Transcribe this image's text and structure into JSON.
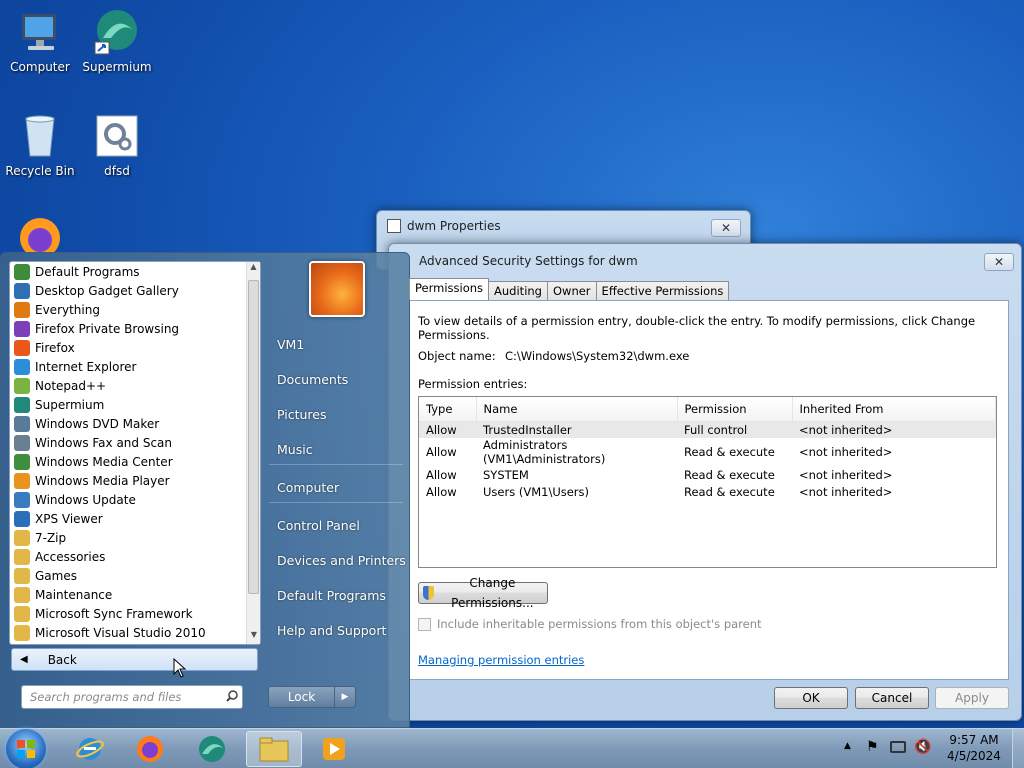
{
  "desktop": {
    "icons": [
      {
        "label": "Computer"
      },
      {
        "label": "Supermium"
      },
      {
        "label": "Recycle Bin"
      },
      {
        "label": "dfsd"
      }
    ]
  },
  "dwm_window": {
    "title": "dwm Properties",
    "close_label": "✕"
  },
  "adv_window": {
    "title": "Advanced Security Settings for dwm",
    "close_label": "✕",
    "tabs": [
      "Permissions",
      "Auditing",
      "Owner",
      "Effective Permissions"
    ],
    "instructions": "To view details of a permission entry, double-click the entry. To modify permissions, click Change Permissions.",
    "object_name_label": "Object name:",
    "object_name_value": "C:\\Windows\\System32\\dwm.exe",
    "entries_label": "Permission entries:",
    "columns": [
      "Type",
      "Name",
      "Permission",
      "Inherited From"
    ],
    "rows": [
      {
        "type": "Allow",
        "name": "TrustedInstaller",
        "permission": "Full control",
        "inherited": "<not inherited>"
      },
      {
        "type": "Allow",
        "name": "Administrators (VM1\\Administrators)",
        "permission": "Read & execute",
        "inherited": "<not inherited>"
      },
      {
        "type": "Allow",
        "name": "SYSTEM",
        "permission": "Read & execute",
        "inherited": "<not inherited>"
      },
      {
        "type": "Allow",
        "name": "Users (VM1\\Users)",
        "permission": "Read & execute",
        "inherited": "<not inherited>"
      }
    ],
    "change_button": "Change Permissions...",
    "inherit_checkbox": "Include inheritable permissions from this object's parent",
    "link": "Managing permission entries",
    "ok": "OK",
    "cancel": "Cancel",
    "apply": "Apply"
  },
  "start_menu": {
    "programs": [
      {
        "label": "Default Programs",
        "color": "#3c8c3c"
      },
      {
        "label": "Desktop Gadget Gallery",
        "color": "#2f6fb3"
      },
      {
        "label": "Everything",
        "color": "#e07a10"
      },
      {
        "label": "Firefox Private Browsing",
        "color": "#7d3fb8"
      },
      {
        "label": "Firefox",
        "color": "#e8581c"
      },
      {
        "label": "Internet Explorer",
        "color": "#2a8fd8"
      },
      {
        "label": "Notepad++",
        "color": "#7bb342"
      },
      {
        "label": "Supermium",
        "color": "#1f8a7a"
      },
      {
        "label": "Windows DVD Maker",
        "color": "#5a7a9a"
      },
      {
        "label": "Windows Fax and Scan",
        "color": "#6b7f93"
      },
      {
        "label": "Windows Media Center",
        "color": "#3d8f3d"
      },
      {
        "label": "Windows Media Player",
        "color": "#e8941c"
      },
      {
        "label": "Windows Update",
        "color": "#3a7ac0"
      },
      {
        "label": "XPS Viewer",
        "color": "#2a6fb8"
      },
      {
        "label": "7-Zip",
        "color": "#e3b648"
      },
      {
        "label": "Accessories",
        "color": "#e3b648"
      },
      {
        "label": "Games",
        "color": "#e3b648"
      },
      {
        "label": "Maintenance",
        "color": "#e3b648"
      },
      {
        "label": "Microsoft Sync Framework",
        "color": "#e3b648"
      },
      {
        "label": "Microsoft Visual Studio 2010",
        "color": "#e3b648"
      }
    ],
    "back_label": "Back",
    "search_placeholder": "Search programs and files",
    "right_items": [
      "VM1",
      "Documents",
      "Pictures",
      "Music",
      "Computer",
      "Control Panel",
      "Devices and Printers",
      "Default Programs",
      "Help and Support"
    ],
    "lock_label": "Lock"
  },
  "tray": {
    "time": "9:57 AM",
    "date": "4/5/2024"
  }
}
